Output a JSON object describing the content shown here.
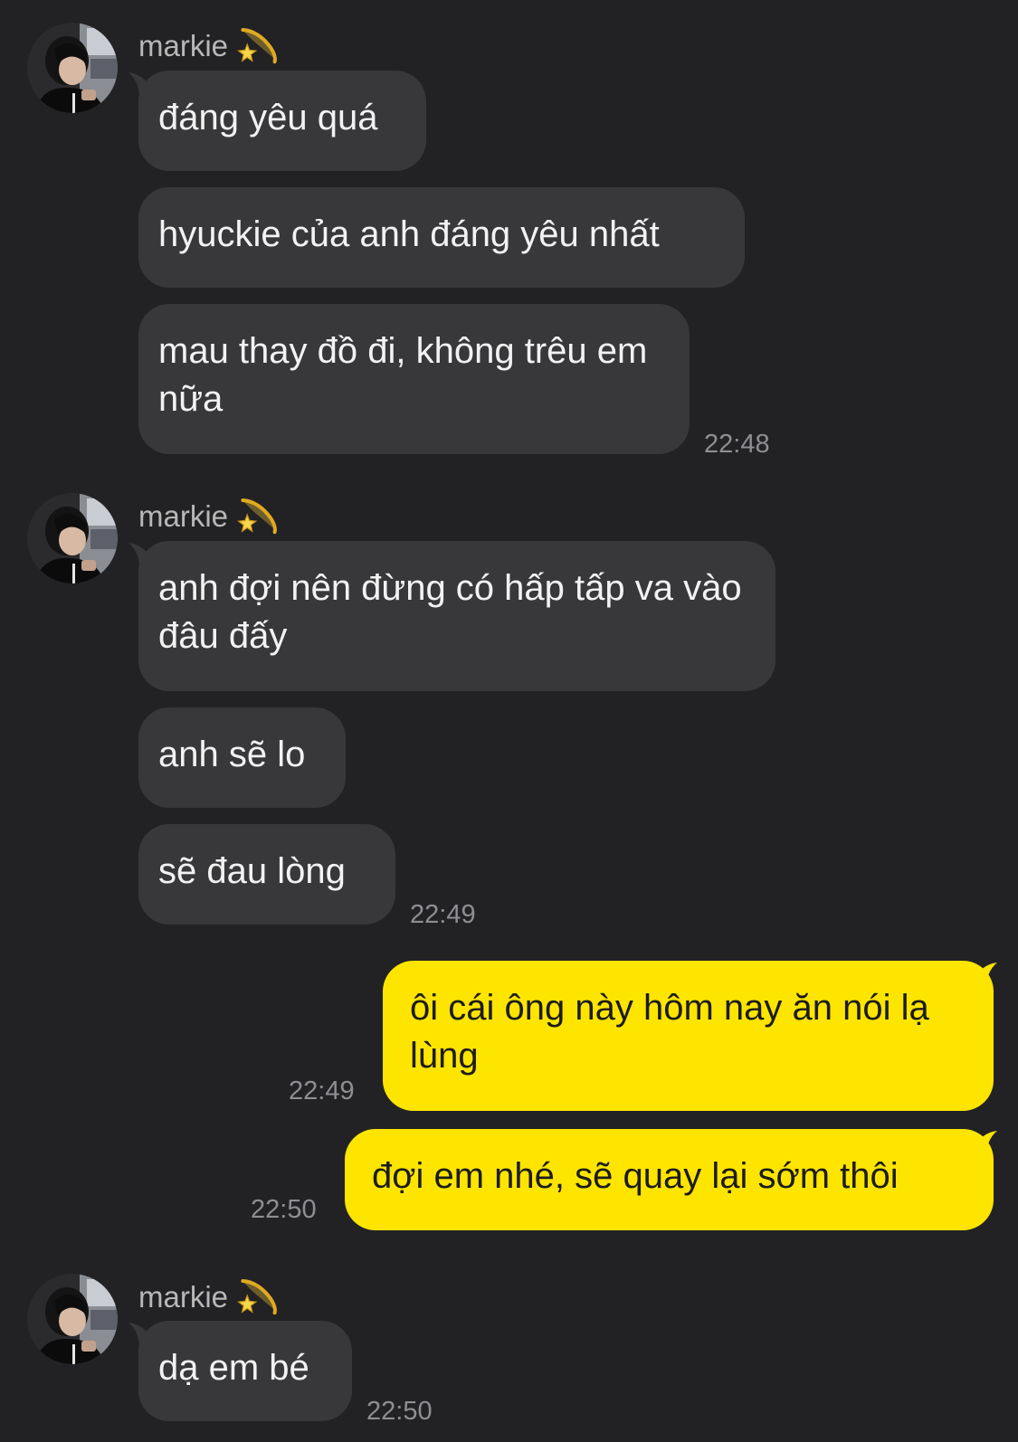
{
  "groups": [
    {
      "sender": "markie",
      "sender_emoji": "dizzy-icon",
      "messages": [
        "đáng yêu quá",
        "hyuckie của anh đáng yêu nhất",
        "mau thay đồ đi, không trêu em nữa"
      ],
      "time": "22:48"
    },
    {
      "sender": "markie",
      "sender_emoji": "dizzy-icon",
      "messages": [
        "anh đợi nên đừng có hấp tấp va vào đâu đấy",
        "anh sẽ lo",
        "sẽ đau lòng"
      ],
      "time": "22:49"
    },
    {
      "outgoing": true,
      "messages": [
        {
          "text": "ôi cái ông này hôm nay ăn nói lạ lùng",
          "time": "22:49"
        },
        {
          "text": "đợi em nhé, sẽ quay lại sớm thôi",
          "time": "22:50"
        }
      ]
    },
    {
      "sender": "markie",
      "sender_emoji": "dizzy-icon",
      "messages": [
        "dạ em bé"
      ],
      "time": "22:50"
    }
  ],
  "colors": {
    "background": "#222224",
    "incoming_bubble": "#38383b",
    "outgoing_bubble": "#fee500",
    "timestamp": "#8e8e93"
  }
}
